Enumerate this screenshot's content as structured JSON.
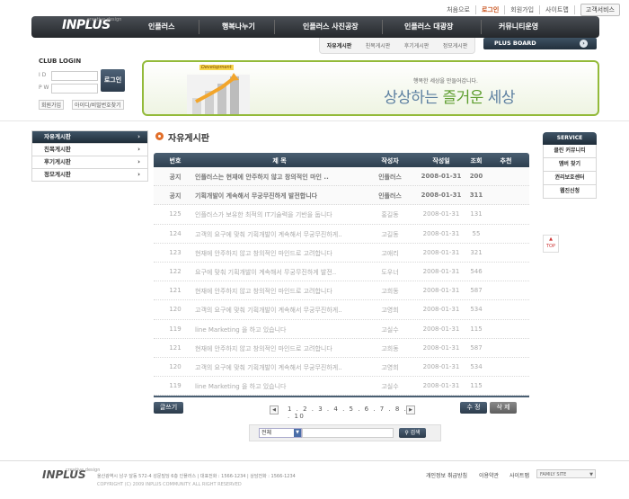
{
  "util": {
    "links": [
      "처음으로",
      "로그인",
      "회원가입",
      "사이트맵"
    ],
    "active": "로그인",
    "service_btn": "고객서비스"
  },
  "brand": {
    "logo": "INPLUS",
    "tagline": "creative design"
  },
  "nav": {
    "items": [
      "인플러스",
      "행복나누기",
      "인플러스 사진공장",
      "인플러스 대광장",
      "커뮤니티운영"
    ]
  },
  "submenu": {
    "items": [
      "자유게시판",
      "친목게시판",
      "후기게시판",
      "정모게시판"
    ],
    "active": "자유게시판"
  },
  "plus_board": {
    "label": "PLUS BOARD"
  },
  "login": {
    "title": "CLUB LOGIN",
    "id_label": "I D",
    "pw_label": "P W",
    "button": "로그인",
    "join": "회원가입",
    "find": "아이디/비밀번호찾기"
  },
  "banner": {
    "badge": "Development",
    "small_text": "행복한 세상을 만들어갑니다.",
    "big_text_a": "상상하는 ",
    "big_text_b": "즐거운",
    "big_text_c": " 세상"
  },
  "sidebar": {
    "items": [
      {
        "label": "자유게시판"
      },
      {
        "label": "친목게시판"
      },
      {
        "label": "후기게시판"
      },
      {
        "label": "정모게시판"
      }
    ]
  },
  "content": {
    "title": "자유게시판"
  },
  "table": {
    "headers": [
      "번호",
      "제  목",
      "작성자",
      "작성일",
      "조회",
      "추천"
    ],
    "rows": [
      {
        "no": "공지",
        "title": "인플러스는 현재에 안주하지 않고 창의적인 마인 ..",
        "author": "인플러스",
        "date": "2008-01-31",
        "views": "200",
        "rec": "",
        "notice": true
      },
      {
        "no": "공지",
        "title": "기획개발이 계속해서 무궁무진하게 발전합니다",
        "author": "인플러스",
        "date": "2008-01-31",
        "views": "311",
        "rec": "",
        "notice": true
      },
      {
        "no": "125",
        "title": "인플러스가 보유한 최적의 IT기술력을 기반을 둡니다",
        "author": "홍길동",
        "date": "2008-01-31",
        "views": "131",
        "rec": ""
      },
      {
        "no": "124",
        "title": "고객의 요구에 맞춰 기획개발이 계속해서 무궁무진하게..",
        "author": "고길동",
        "date": "2008-01-31",
        "views": "55",
        "rec": ""
      },
      {
        "no": "123",
        "title": "현재에 안주하지 않고 창의적인 마인드로 고려합니다",
        "author": "고애리",
        "date": "2008-01-31",
        "views": "321",
        "rec": ""
      },
      {
        "no": "122",
        "title": "요구에 맞춰 기획개발이 계속해서 무궁무진하게 발전..",
        "author": "도우너",
        "date": "2008-01-31",
        "views": "546",
        "rec": ""
      },
      {
        "no": "121",
        "title": "현재에 안주하지 않고 창의적인 마인드로 고려합니다",
        "author": "고희동",
        "date": "2008-01-31",
        "views": "587",
        "rec": ""
      },
      {
        "no": "120",
        "title": "고객의 요구에 맞춰 기획개발이 계속해서 무궁무진하게..",
        "author": "고영희",
        "date": "2008-01-31",
        "views": "534",
        "rec": ""
      },
      {
        "no": "119",
        "title": "line Marketing 을 하고 있습니다",
        "author": "고실수",
        "date": "2008-01-31",
        "views": "115",
        "rec": ""
      },
      {
        "no": "121",
        "title": "현재에 안주하지 않고 창의적인 마인드로 고려합니다",
        "author": "고희동",
        "date": "2008-01-31",
        "views": "587",
        "rec": ""
      },
      {
        "no": "120",
        "title": "고객의 요구에 맞춰 기획개발이 계속해서 무궁무진하게..",
        "author": "고영희",
        "date": "2008-01-31",
        "views": "534",
        "rec": ""
      },
      {
        "no": "119",
        "title": "line Marketing 을 하고 있습니다",
        "author": "고실수",
        "date": "2008-01-31",
        "views": "115",
        "rec": ""
      }
    ]
  },
  "actions": {
    "write": "글쓰기",
    "edit": "수 정",
    "delete": "삭 제"
  },
  "pagination": {
    "pages": "1 . 2 . 3 . 4 . 5 . 6 . 7 . 8 . 9 . 10",
    "prev": "◀",
    "next": "▶"
  },
  "search": {
    "select_value": "전체",
    "button": "검색"
  },
  "service": {
    "title": "SERVICE",
    "items": [
      "클린 커뮤니티",
      "멤버 찾기",
      "권리보호센터",
      "웹진신청"
    ]
  },
  "top_button": {
    "arrow": "▲",
    "label": "TOP"
  },
  "footer": {
    "logo": "INPLUS",
    "address": "울산광역시 남구 달동 572-4 성문빌딩 6층 인플러스  |  대표전화 : 1566-1234  |  상담전화 : 1566-1234",
    "copyright": "COPYRIGHT (C) 2009  INPLUS COMMUNITY. ALL RIGHT RESERVED",
    "links": [
      "개인정보 취급방침",
      "이용약관",
      "사이트맵"
    ],
    "family_site": "FAMILY SITE"
  },
  "colors": {
    "nav_dark": "#2e3f4f",
    "accent_orange": "#e26f2a",
    "banner_green": "#93ba3a"
  }
}
